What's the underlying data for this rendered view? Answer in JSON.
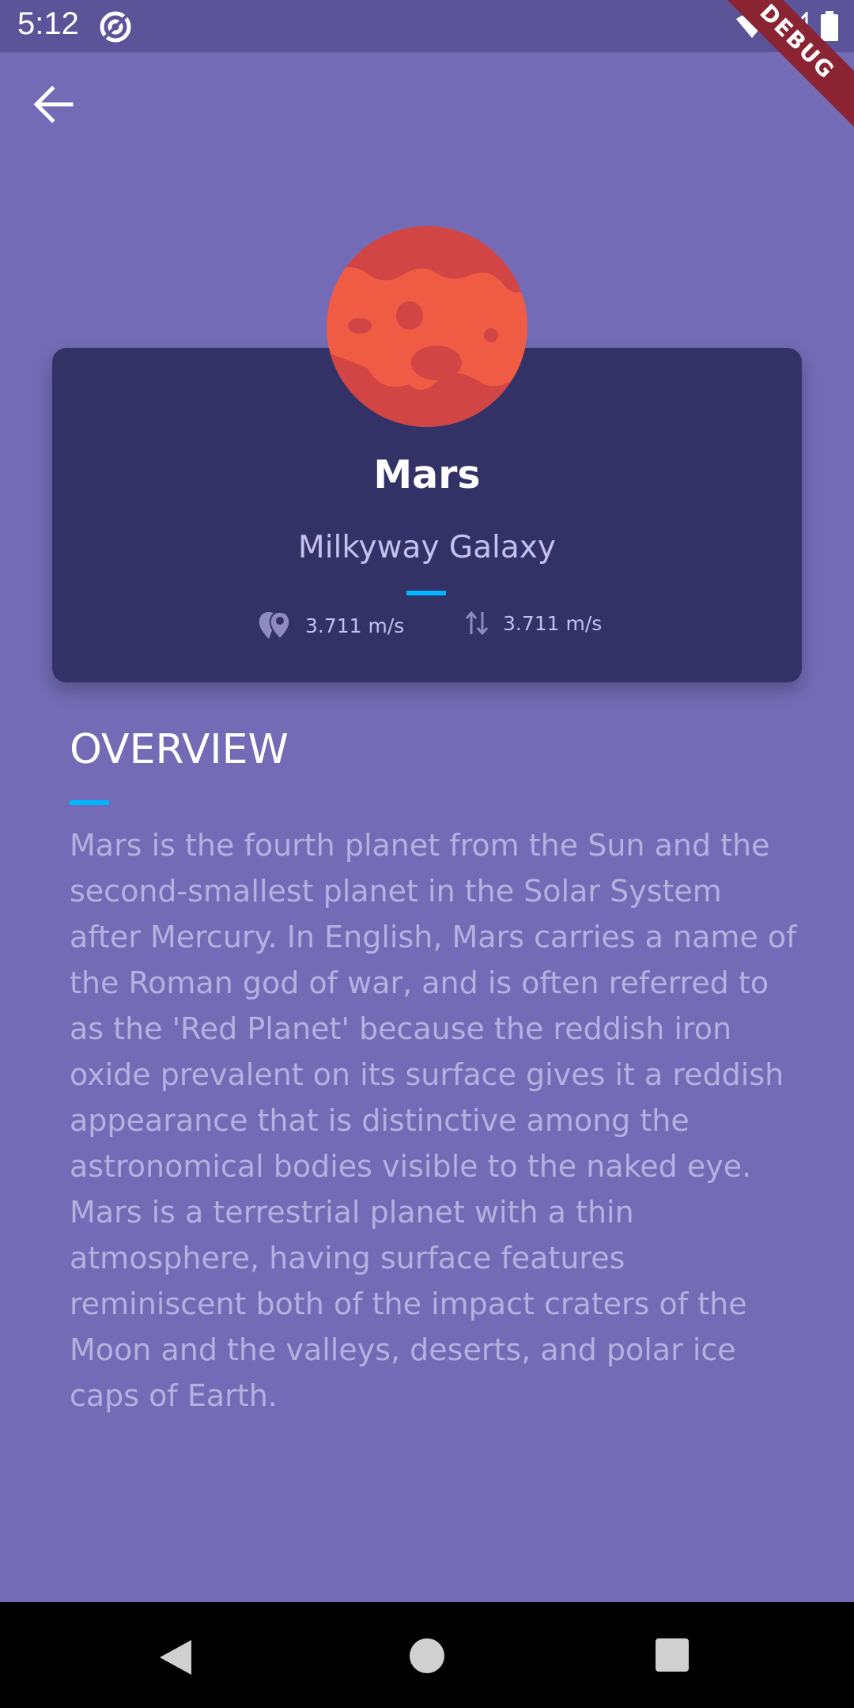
{
  "status_bar": {
    "time": "5:12",
    "debug_label": "DEBUG"
  },
  "planet": {
    "name": "Mars",
    "galaxy": "Milkyway Galaxy",
    "stats": [
      {
        "icon": "location-icon",
        "value": "3.711 m/s"
      },
      {
        "icon": "gravity-arrows-icon",
        "value": "3.711 m/s"
      }
    ]
  },
  "overview": {
    "title": "OVERVIEW",
    "text": "Mars is the fourth planet from the Sun and the second-smallest planet in the Solar System after Mercury. In English, Mars carries a name of the Roman god of war, and is often referred to as the 'Red Planet' because the reddish iron oxide prevalent on its surface gives it a reddish appearance that is distinctive among the astronomical bodies visible to the naked eye. Mars is a terrestrial planet with a thin atmosphere, having surface features reminiscent both of the impact craters of the Moon and the valleys, deserts, and polar ice caps of Earth."
  },
  "colors": {
    "background": "#736bb5",
    "card": "#333266",
    "accent": "#00b6ff",
    "planet": "#f05b44"
  }
}
